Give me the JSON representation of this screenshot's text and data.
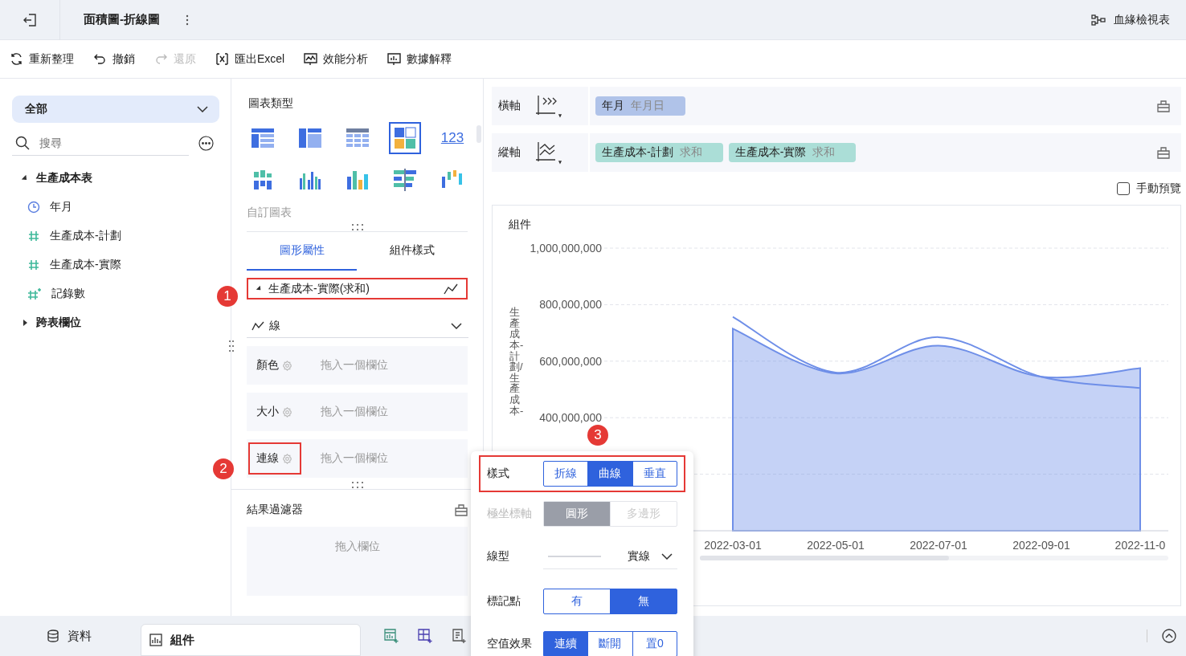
{
  "header": {
    "title": "面積圖-折線圖",
    "lineage_link": "血緣檢視表"
  },
  "toolbar": [
    {
      "label": "重新整理",
      "kind": "refresh",
      "disabled": false
    },
    {
      "label": "撤銷",
      "kind": "undo",
      "disabled": false
    },
    {
      "label": "還原",
      "kind": "redo",
      "disabled": true
    },
    {
      "label": "匯出Excel",
      "kind": "excel",
      "disabled": false
    },
    {
      "label": "效能分析",
      "kind": "performance",
      "disabled": false
    },
    {
      "label": "數據解釋",
      "kind": "explain",
      "disabled": false
    }
  ],
  "data_panel": {
    "scope": "全部",
    "search": {
      "placeholder": "搜尋"
    },
    "tree": [
      {
        "label": "生產成本表",
        "expanded": true,
        "children": [
          {
            "label": "年月",
            "kind": "date"
          },
          {
            "label": "生產成本-計劃",
            "kind": "number"
          },
          {
            "label": "生產成本-實際",
            "kind": "number"
          },
          {
            "label": "記錄數",
            "kind": "count"
          }
        ]
      },
      {
        "label": "跨表欄位",
        "expanded": false
      }
    ]
  },
  "chart_types": {
    "title": "圖表類型",
    "items": [
      {
        "kind": "table",
        "selected": false
      },
      {
        "kind": "pivot",
        "selected": false
      },
      {
        "kind": "detail",
        "selected": false
      },
      {
        "kind": "tiles",
        "selected": true
      },
      {
        "kind": "number",
        "label": "123",
        "selected": false
      },
      {
        "kind": "grouped",
        "selected": false
      },
      {
        "kind": "multibar",
        "selected": false
      },
      {
        "kind": "colorbar",
        "selected": false
      },
      {
        "kind": "hbar",
        "selected": false
      },
      {
        "kind": "float",
        "selected": false
      }
    ],
    "custom": "自訂圖表"
  },
  "property_tabs": [
    {
      "label": "圖形屬性",
      "selected": true
    },
    {
      "label": "組件樣式",
      "selected": false
    }
  ],
  "series": {
    "label": "生產成本-實際(求和)",
    "expanded": true,
    "highlighted": true,
    "marker": "1"
  },
  "mark_type": "線",
  "fields": [
    {
      "label": "顏色",
      "placeholder": "拖入一個欄位",
      "highlighted": false
    },
    {
      "label": "大小",
      "placeholder": "拖入一個欄位",
      "highlighted": false
    },
    {
      "label": "連線",
      "placeholder": "拖入一個欄位",
      "highlighted": true,
      "marker": "2"
    }
  ],
  "result_filter": {
    "title": "結果過濾器",
    "placeholder": "拖入欄位"
  },
  "axes": [
    {
      "label": "橫軸",
      "kind": "x",
      "chips": [
        {
          "name": "年月",
          "detail": "年月日",
          "kind": "dimension"
        }
      ]
    },
    {
      "label": "縱軸",
      "kind": "y",
      "chips": [
        {
          "name": "生產成本-計劃",
          "detail": "求和",
          "kind": "measure"
        },
        {
          "name": "生產成本-實際",
          "detail": "求和",
          "kind": "measure"
        }
      ]
    }
  ],
  "manual_preview": {
    "label": "手動預覽",
    "checked": false
  },
  "chart": {
    "title": "組件",
    "chart_data": {
      "type": "area",
      "ylabel": "生產成本-計劃/生產成本-",
      "x": [
        "2022-03-01",
        "2022-05-01",
        "2022-07-01",
        "2022-09-01",
        "2022-11-0"
      ],
      "series": [
        {
          "type": "area",
          "color": "#6f8fe8",
          "values": [
            715000000,
            557000000,
            655000000,
            545000000,
            575000000
          ]
        },
        {
          "type": "line",
          "color": "#6f8fe8",
          "values": [
            757000000,
            560000000,
            685000000,
            545000000,
            505000000
          ]
        }
      ],
      "ylim": [
        0,
        1000000000
      ],
      "grid": true,
      "yticks": [
        {
          "value": 400000000,
          "label": "400,000,000"
        },
        {
          "value": 600000000,
          "label": "600,000,000"
        },
        {
          "value": 800000000,
          "label": "800,000,000"
        },
        {
          "value": 1000000000,
          "label": "1,000,000,000"
        }
      ]
    }
  },
  "line_popup": {
    "marker": "3",
    "rows": [
      {
        "label": "樣式",
        "kind": "segmented",
        "disabled": false,
        "highlighted": true,
        "options": [
          {
            "label": "折線",
            "selected": false
          },
          {
            "label": "曲線",
            "selected": true
          },
          {
            "label": "垂直",
            "selected": false
          }
        ]
      },
      {
        "label": "極坐標軸",
        "kind": "segmented",
        "disabled": true,
        "highlighted": false,
        "options": [
          {
            "label": "圓形",
            "selected": true
          },
          {
            "label": "多邊形",
            "selected": false
          }
        ]
      },
      {
        "label": "線型",
        "kind": "select",
        "disabled": false,
        "highlighted": false,
        "value": "實線"
      },
      {
        "label": "標記點",
        "kind": "segmented",
        "disabled": false,
        "highlighted": false,
        "options": [
          {
            "label": "有",
            "selected": false
          },
          {
            "label": "無",
            "selected": true
          }
        ]
      },
      {
        "label": "空值效果",
        "kind": "segmented",
        "disabled": false,
        "highlighted": false,
        "options": [
          {
            "label": "連續",
            "selected": true
          },
          {
            "label": "斷開",
            "selected": false
          },
          {
            "label": "置0",
            "selected": false
          }
        ]
      }
    ]
  },
  "bottom_tabs": [
    {
      "label": "資料",
      "kind": "data",
      "selected": false
    },
    {
      "label": "組件",
      "kind": "widget",
      "selected": true
    }
  ]
}
